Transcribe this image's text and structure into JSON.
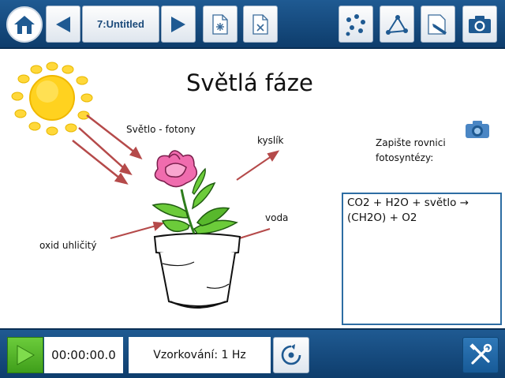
{
  "toolbar": {
    "page_label": "7:Untitled",
    "icons": [
      "home-icon",
      "previous-page-icon",
      "next-page-icon",
      "add-page-icon",
      "delete-page-icon",
      "sensor-data-icon",
      "graph-icon",
      "annotate-icon",
      "camera-icon"
    ]
  },
  "content": {
    "title": "Světlá fáze",
    "labels": {
      "light": "Světlo - fotony",
      "oxygen": "kyslík",
      "water": "voda",
      "co2": "oxid uhličitý"
    },
    "prompt_line1": "Zapište rovnici",
    "prompt_line2": "fotosyntézy:",
    "answer": "CO2 + H2O + světlo →\n(CH2O) + O2"
  },
  "bottom": {
    "timer": "00:00:00.0",
    "sampling": "Vzorkování: 1 Hz"
  },
  "colors": {
    "bar_blue": "#1a4f84",
    "arrow_red": "#b54a4a",
    "play_green": "#4fb526",
    "box_border": "#2d6da3"
  }
}
